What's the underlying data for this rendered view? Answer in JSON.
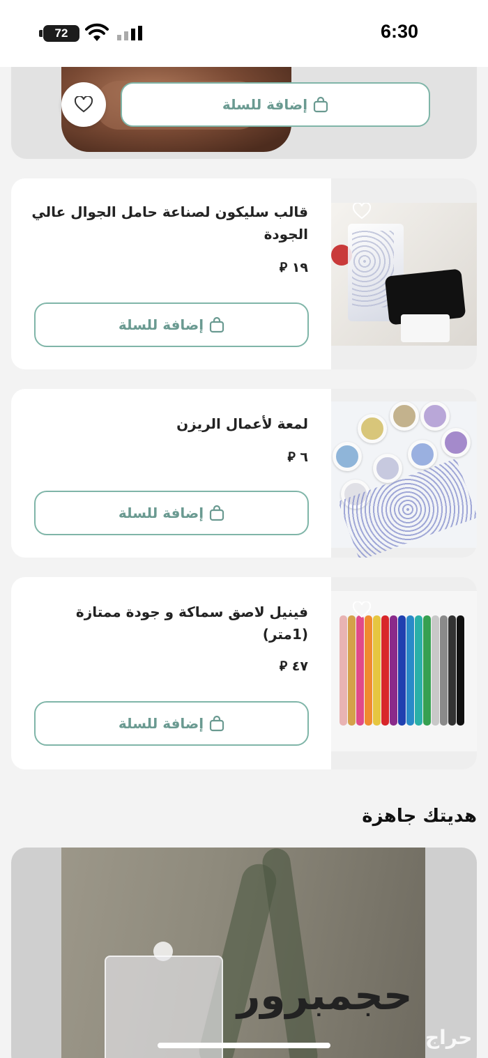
{
  "status_bar": {
    "time": "6:30",
    "battery": "72"
  },
  "top_product": {
    "add_to_cart_label": "إضافة للسلة"
  },
  "products": [
    {
      "title": "قالب سليكون لصناعة حامل الجوال عالي الجودة",
      "price": "١٩",
      "currency_icon": "riyal-icon",
      "add_to_cart_label": "إضافة للسلة"
    },
    {
      "title": "لمعة لأعمال الريزن",
      "price": "٦",
      "currency_icon": "riyal-icon",
      "add_to_cart_label": "إضافة للسلة"
    },
    {
      "title": "فينيل لاصق سماكة و جودة ممتازة (1متر)",
      "price": "٤٧",
      "currency_icon": "riyal-icon",
      "add_to_cart_label": "إضافة للسلة"
    }
  ],
  "gift_section": {
    "title": "هديتك جاهزة",
    "brand_text": "حجمبرور"
  },
  "watermark": "حراج",
  "colors": {
    "accent": "#7fb5a8",
    "accent_text": "#6a9a91",
    "card_bg": "#ffffff",
    "page_bg": "#f3f3f3"
  }
}
